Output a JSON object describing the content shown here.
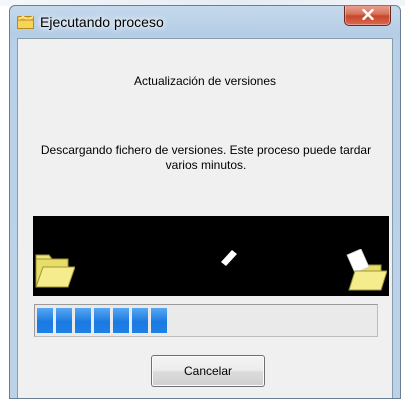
{
  "window": {
    "title": "Ejecutando proceso",
    "icon": "app-folder-icon",
    "close_icon": "close-icon"
  },
  "dialog": {
    "heading": "Actualización de versiones",
    "message": "Descargando fichero de versiones. Este proceso puede tardar varios minutos."
  },
  "animation": {
    "source_icon": "folder-icon",
    "destination_icon": "folder-with-document-icon",
    "moving_icon": "flying-document-icon",
    "background": "#000000"
  },
  "progress": {
    "filled_blocks": 7,
    "fraction": 0.39,
    "color": "#1f80e6"
  },
  "buttons": {
    "cancel_label": "Cancelar"
  }
}
